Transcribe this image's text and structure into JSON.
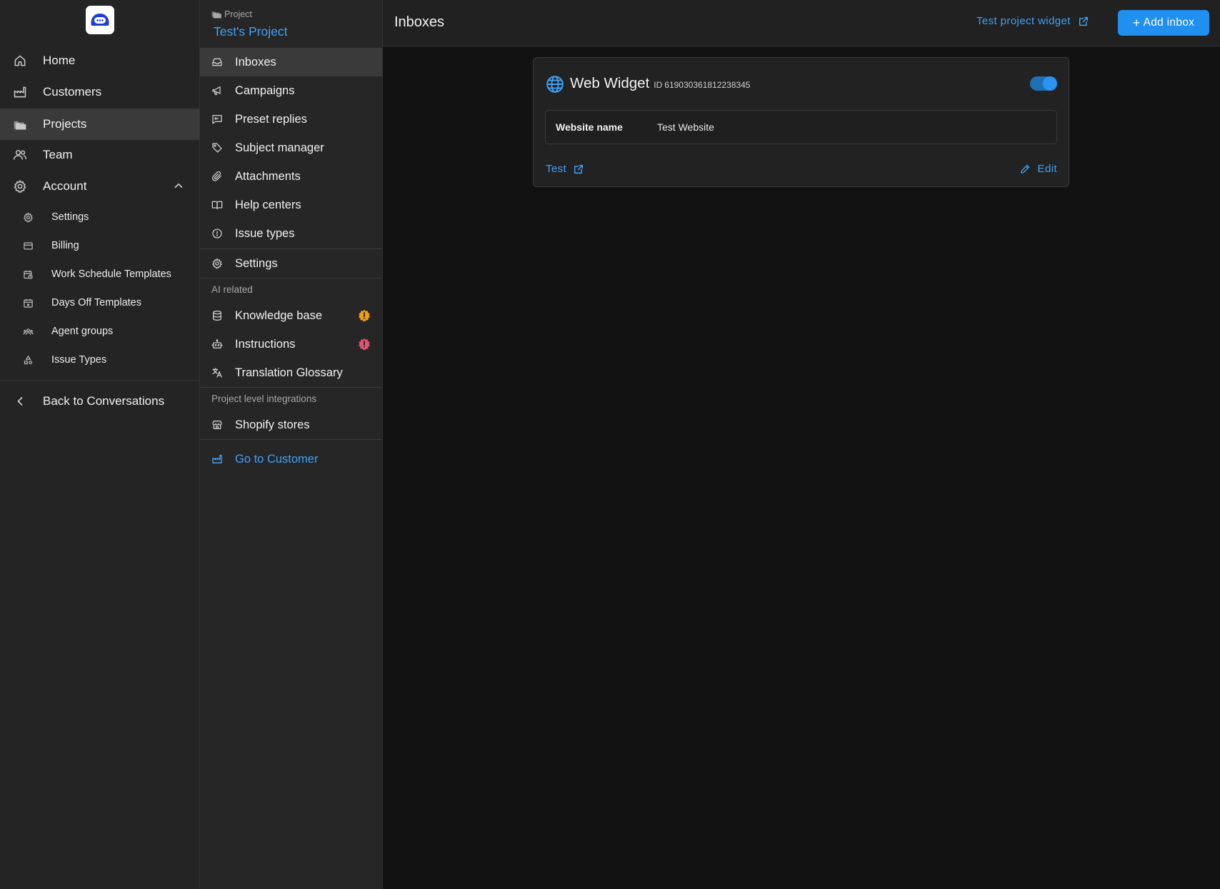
{
  "sidebar": {
    "logo": "chat-bubble-logo",
    "items": [
      {
        "label": "Home",
        "icon": "home-icon"
      },
      {
        "label": "Customers",
        "icon": "factory-icon"
      },
      {
        "label": "Projects",
        "icon": "folders-icon",
        "active": true
      },
      {
        "label": "Team",
        "icon": "users-icon"
      },
      {
        "label": "Account",
        "icon": "gear-icon",
        "expanded": true
      }
    ],
    "account_items": [
      {
        "label": "Settings",
        "icon": "gear-icon"
      },
      {
        "label": "Billing",
        "icon": "credit-card-icon"
      },
      {
        "label": "Work Schedule Templates",
        "icon": "calendar-clock-icon"
      },
      {
        "label": "Days Off Templates",
        "icon": "calendar-x-icon"
      },
      {
        "label": "Agent groups",
        "icon": "users-group-icon"
      },
      {
        "label": "Issue Types",
        "icon": "shapes-icon"
      }
    ],
    "back_label": "Back to Conversations"
  },
  "project_sidebar": {
    "caption": "Project",
    "project_name": "Test's Project",
    "items": [
      {
        "label": "Inboxes",
        "icon": "inbox-icon",
        "active": true
      },
      {
        "label": "Campaigns",
        "icon": "megaphone-icon"
      },
      {
        "label": "Preset replies",
        "icon": "message-reply-icon"
      },
      {
        "label": "Subject manager",
        "icon": "tag-icon"
      },
      {
        "label": "Attachments",
        "icon": "paperclip-icon"
      },
      {
        "label": "Help centers",
        "icon": "book-open-icon"
      },
      {
        "label": "Issue types",
        "icon": "alert-circle-icon"
      }
    ],
    "settings_label": "Settings",
    "ai_section_label": "AI related",
    "ai_items": [
      {
        "label": "Knowledge base",
        "icon": "database-icon",
        "badge": "warning-badge",
        "badge_color": "#f59e0b"
      },
      {
        "label": "Instructions",
        "icon": "robot-icon",
        "badge": "error-badge",
        "badge_color": "#e05570"
      },
      {
        "label": "Translation Glossary",
        "icon": "language-icon"
      }
    ],
    "integrations_label": "Project level integrations",
    "integration_items": [
      {
        "label": "Shopify stores",
        "icon": "store-icon"
      }
    ],
    "go_to_customer_label": "Go to Customer"
  },
  "header": {
    "title": "Inboxes",
    "test_widget_label": "Test project widget",
    "add_inbox_label": "Add inbox"
  },
  "inbox_card": {
    "title": "Web Widget",
    "id_label": "ID",
    "id": "619030361812238345",
    "enabled": true,
    "field_name": "Website name",
    "field_value": "Test Website",
    "test_label": "Test",
    "edit_label": "Edit"
  },
  "colors": {
    "accent": "#3fa2f7",
    "button": "#1f8ff0",
    "background": "#121212",
    "sidebar": "#242424"
  }
}
